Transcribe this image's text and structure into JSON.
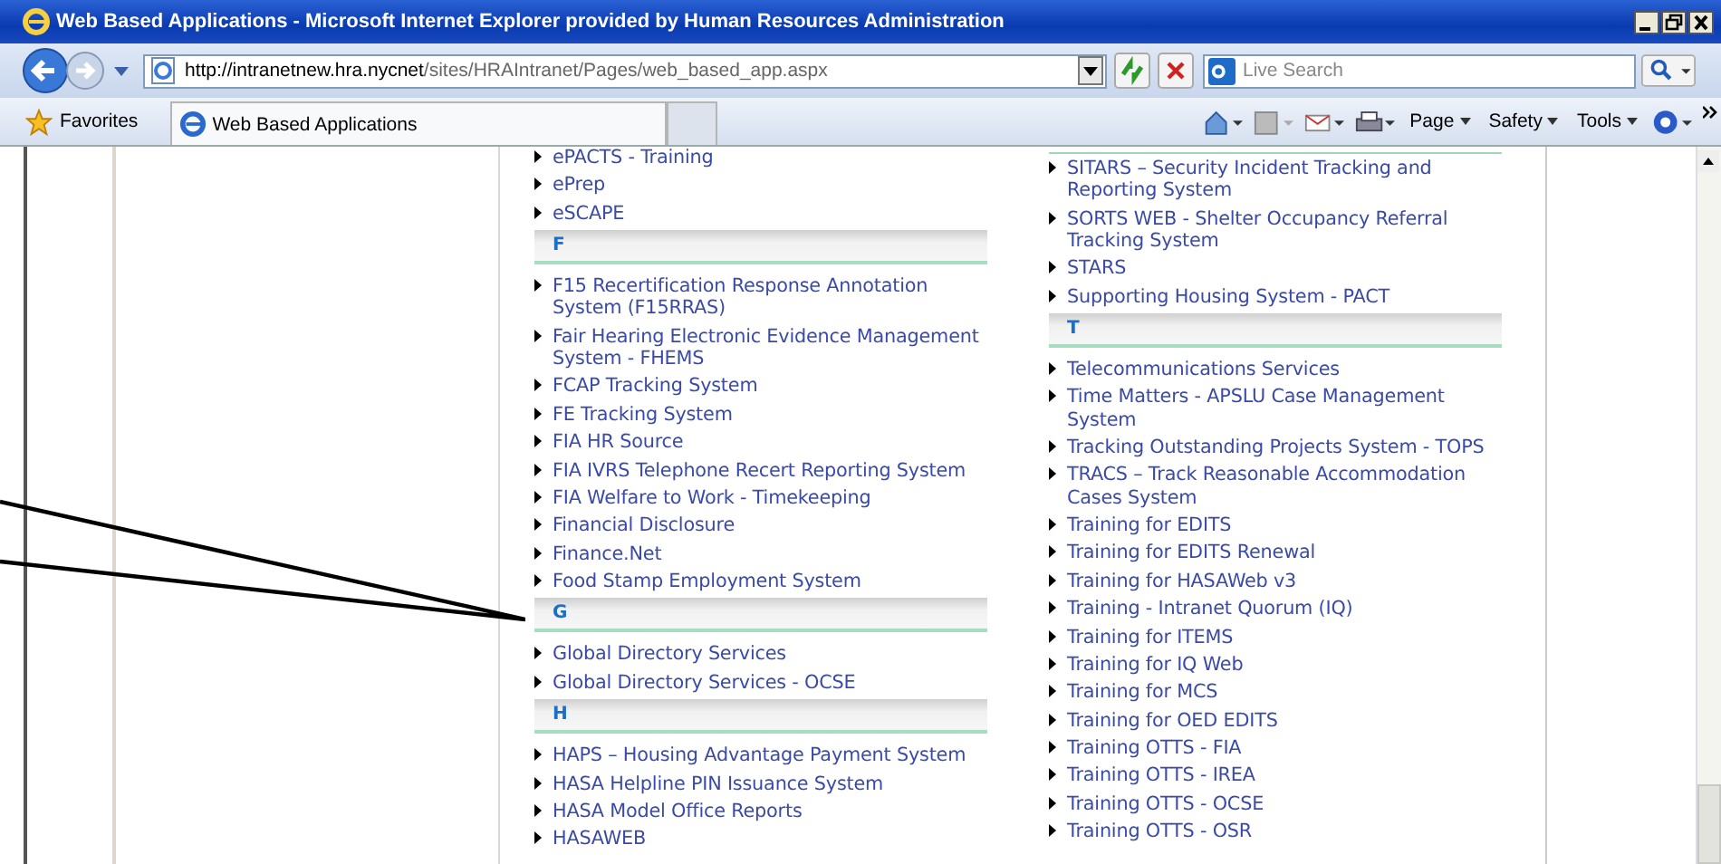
{
  "window": {
    "title": "Web Based Applications - Microsoft Internet Explorer provided by Human Resources Administration"
  },
  "address_bar": {
    "url_host": "http://intranetnew.hra.nycnet",
    "url_path": "/sites/HRAIntranet/Pages/web_based_app.aspx"
  },
  "search": {
    "placeholder": "Live Search"
  },
  "favorites": {
    "label": "Favorites"
  },
  "tabs": [
    {
      "label": "Web Based Applications",
      "selected": true
    }
  ],
  "command_bar": [
    "Page",
    "Safety",
    "Tools"
  ],
  "columns": [
    {
      "sections": [
        {
          "items": [
            "ePACTS - Training",
            "ePrep",
            "eSCAPE"
          ]
        },
        {
          "letter": "F",
          "items": [
            "F15 Recertification Response Annotation System (F15RRAS)",
            "Fair Hearing Electronic Evidence Management System - FHEMS",
            "FCAP Tracking System",
            "FE Tracking System",
            "FIA HR Source",
            "FIA IVRS Telephone Recert Reporting System",
            "FIA Welfare to Work - Timekeeping",
            "Financial Disclosure",
            "Finance.Net",
            "Food Stamp Employment System"
          ]
        },
        {
          "letter": "G",
          "items": [
            "Global Directory Services",
            "Global Directory Services - OCSE"
          ]
        },
        {
          "letter": "H",
          "items": [
            "HAPS – Housing Advantage Payment System",
            "HASA Helpline PIN Issuance System",
            "HASA Model Office Reports",
            "HASAWEB"
          ]
        }
      ]
    },
    {
      "sections": [
        {
          "items": [
            "SITARS – Security Incident Tracking and Reporting System",
            "SORTS WEB - Shelter Occupancy Referral Tracking System",
            "STARS",
            "Supporting Housing System - PACT"
          ]
        },
        {
          "letter": "T",
          "items": [
            "Telecommunications Services",
            "Time Matters - APSLU Case Management System",
            "Tracking Outstanding Projects System - TOPS",
            "TRACS – Track Reasonable Accommodation Cases System",
            "Training for EDITS",
            "Training for EDITS Renewal",
            "Training for HASAWeb v3",
            "Training - Intranet Quorum (IQ)",
            "Training for ITEMS",
            "Training for IQ Web",
            "Training for MCS",
            "Training for OED EDITS",
            "Training OTTS - FIA",
            "Training OTTS - IREA",
            "Training OTTS - OCSE",
            "Training OTTS - OSR"
          ]
        }
      ]
    }
  ]
}
